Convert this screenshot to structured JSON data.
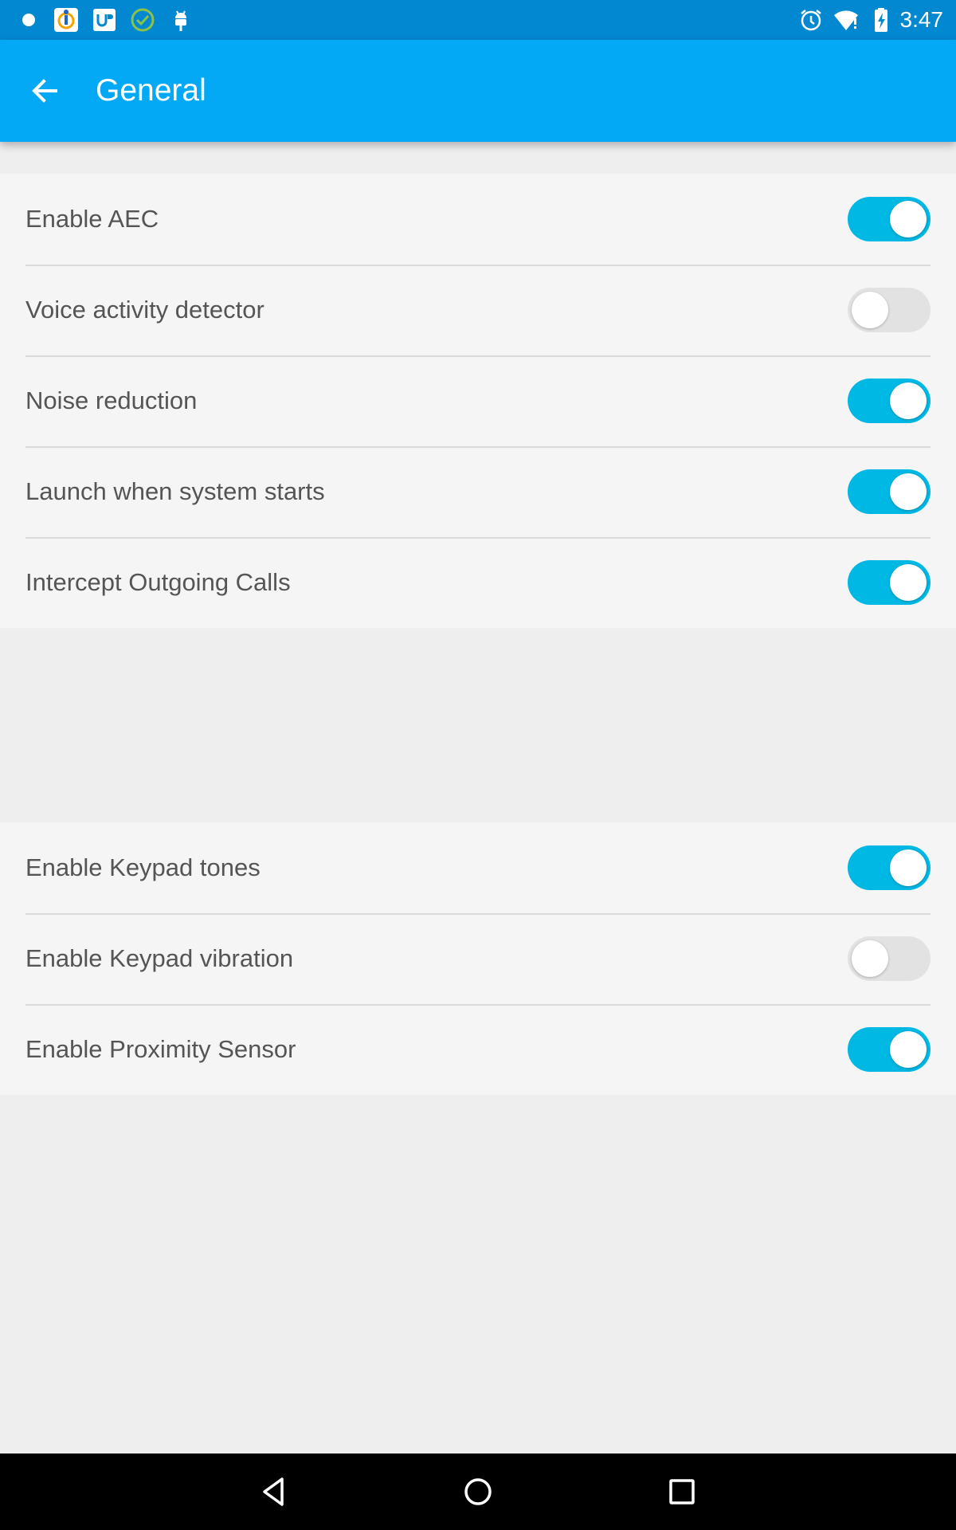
{
  "status_bar": {
    "time": "3:47",
    "left_icons": [
      "dot-icon",
      "app-info-icon",
      "up-app-icon",
      "check-circle-icon",
      "android-icon"
    ],
    "right_icons": [
      "alarm-icon",
      "wifi-icon",
      "battery-charging-icon"
    ]
  },
  "app_bar": {
    "title": "General",
    "back_icon": "arrow-left-icon"
  },
  "sections": [
    {
      "items": [
        {
          "label": "Enable AEC",
          "on": true
        },
        {
          "label": "Voice activity detector",
          "on": false
        },
        {
          "label": "Noise reduction",
          "on": true
        },
        {
          "label": "Launch when system starts",
          "on": true
        },
        {
          "label": "Intercept Outgoing Calls",
          "on": true
        }
      ]
    },
    {
      "items": [
        {
          "label": "Enable Keypad tones",
          "on": true
        },
        {
          "label": "Enable Keypad vibration",
          "on": false
        },
        {
          "label": "Enable Proximity Sensor",
          "on": true
        }
      ]
    }
  ],
  "nav_bar": {
    "icons": [
      "back-triangle-icon",
      "home-circle-icon",
      "recents-square-icon"
    ]
  },
  "colors": {
    "status_bar": "#0288d1",
    "app_bar": "#03a9f4",
    "switch_on": "#00b8e4",
    "switch_off": "#e2e2e2"
  }
}
